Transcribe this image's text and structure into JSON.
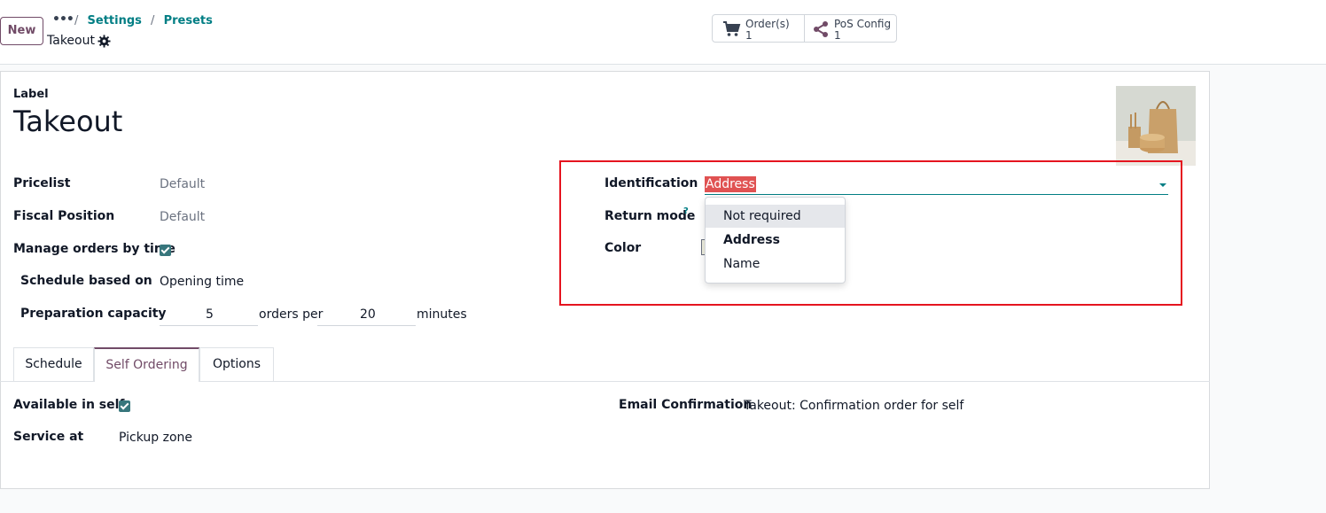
{
  "control_panel": {
    "new_label": "New",
    "more_label": "•••",
    "breadcrumbs": [
      "Settings",
      "Presets"
    ],
    "separator": "/",
    "record_title": "Takeout",
    "smart_buttons": [
      {
        "label": "Order(s)",
        "count": "1",
        "icon": "cart-icon"
      },
      {
        "label": "PoS Config",
        "count": "1",
        "icon": "share-icon"
      }
    ]
  },
  "form": {
    "label_caption": "Label",
    "title": "Takeout",
    "fields_left": [
      {
        "label": "Pricelist",
        "value": "Default"
      },
      {
        "label": "Fiscal Position",
        "value": "Default"
      },
      {
        "label": "Manage orders by time",
        "checked": true
      },
      {
        "label": "Schedule based on",
        "value": "Opening time"
      },
      {
        "label": "Preparation capacity",
        "value1": "5",
        "mid": "orders per",
        "value2": "20",
        "suffix": "minutes"
      }
    ],
    "fields_right": {
      "identification": {
        "label": "Identification",
        "value": "Address"
      },
      "return_mode": {
        "label": "Return mode",
        "help": "?"
      },
      "color": {
        "label": "Color"
      }
    },
    "dropdown_options": [
      "Not required",
      "Address",
      "Name"
    ],
    "tabs": [
      "Schedule",
      "Self Ordering",
      "Options"
    ],
    "active_tab": "Self Ordering",
    "self_ordering": {
      "available_label": "Available in self",
      "available_checked": true,
      "service_label": "Service at",
      "service_value": "Pickup zone",
      "email_label": "Email Confirmation",
      "email_value": "Takeout: Confirmation order for self"
    }
  },
  "colors": {
    "brand": "#714b67",
    "accent": "#017e84",
    "highlight": "#e05252",
    "annotation": "#e5141f"
  }
}
